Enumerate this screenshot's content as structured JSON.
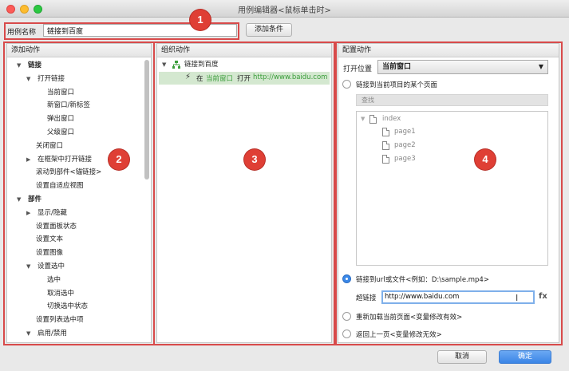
{
  "window": {
    "title": "用例编辑器<鼠标单击时>"
  },
  "toolbar": {
    "case_name_label": "用例名称",
    "case_name_value": "链接到百度",
    "add_condition_label": "添加条件"
  },
  "badges": [
    "1",
    "2",
    "3",
    "4"
  ],
  "add_actions": {
    "header": "添加动作",
    "items": [
      "链接",
      "打开链接",
      "当前窗口",
      "新窗口/新标签",
      "弹出窗口",
      "父级窗口",
      "关闭窗口",
      "在框架中打开链接",
      "滚动到部件<锚链接>",
      "设置自适应视图",
      "部件",
      "显示/隐藏",
      "设置面板状态",
      "设置文本",
      "设置图像",
      "设置选中",
      "选中",
      "取消选中",
      "切换选中状态",
      "设置列表选中项",
      "启用/禁用"
    ]
  },
  "organize": {
    "header": "组织动作",
    "case_name": "链接到百度",
    "action_prefix": "在",
    "action_target": "当前窗口",
    "action_verb": "打开",
    "action_url": "http://www.baidu.com"
  },
  "configure": {
    "header": "配置动作",
    "open_in_label": "打开位置",
    "open_in_value": "当前窗口",
    "link_page_label": "链接到当前项目的某个页面",
    "search_placeholder": "查找",
    "pages": {
      "root": "index",
      "children": [
        "page1",
        "page2",
        "page3"
      ]
    },
    "link_url_label": "链接到url或文件<例如：D:\\sample.mp4>",
    "hyperlink_label": "超链接",
    "hyperlink_value": "http://www.baidu.com",
    "fx_label": "fx",
    "reload_label": "重新加载当前页面<变量修改有效>",
    "back_label": "返回上一页<变量修改无效>"
  },
  "footer": {
    "cancel_label": "取消",
    "ok_label": "确定"
  },
  "colors": {
    "accent": "#3b88e8",
    "highlight": "#d84a4a",
    "selected_row": "#d4e8d0",
    "url": "#3a9d3a"
  }
}
